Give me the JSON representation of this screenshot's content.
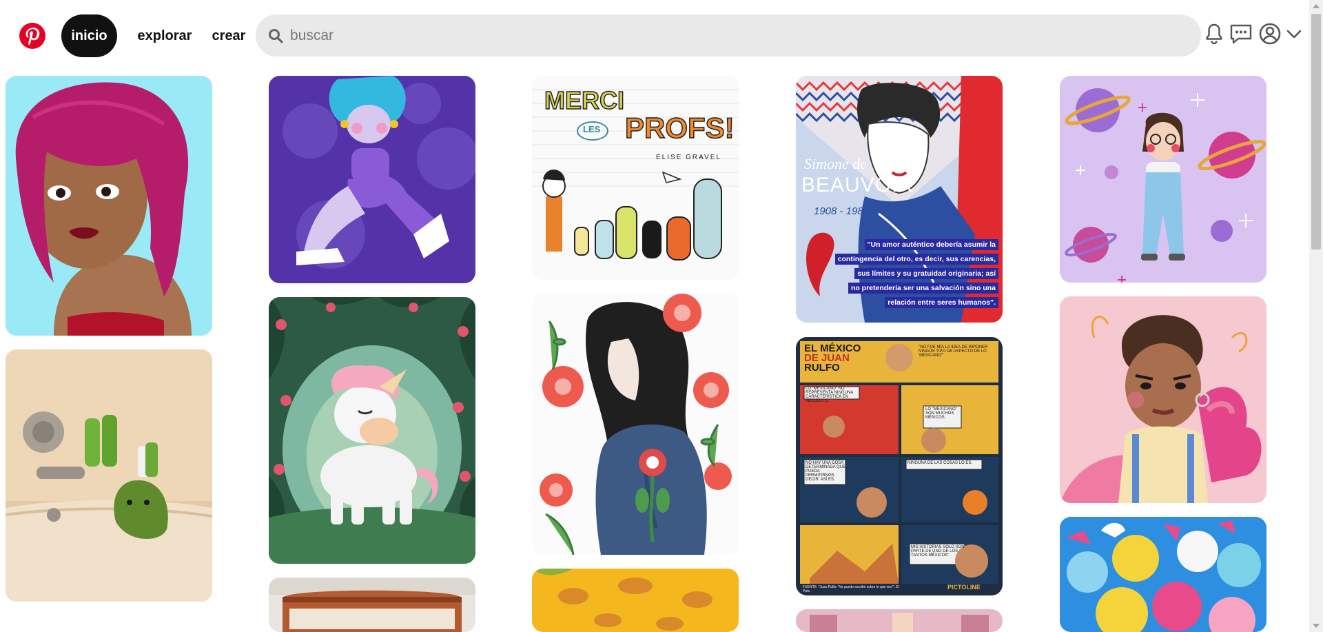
{
  "header": {
    "logo_icon": "pinterest-logo-icon",
    "nav": [
      {
        "label": "inicio",
        "active": true
      },
      {
        "label": "explorar",
        "active": false
      },
      {
        "label": "crear",
        "active": false
      }
    ],
    "search": {
      "placeholder": "buscar",
      "value": ""
    },
    "icons": [
      "bell-icon",
      "message-icon",
      "profile-icon",
      "chevron-down-icon"
    ]
  },
  "pins": {
    "merci": {
      "line1": "MERCI",
      "line2": "LES",
      "line3": "PROFS!",
      "author": "ELISE GRAVEL"
    },
    "beauvoir": {
      "name1": "Simone de",
      "name2": "BEAUVOIR",
      "years": "1908 - 1986",
      "quote": [
        "\"Un amor auténtico debería asumir la",
        "contingencia del otro, es decir, sus carencias,",
        "sus límites y su gratuidad originaria; así",
        "no pretendería ser una salvación sino una",
        "relación entre seres humanos\"."
      ]
    },
    "rulfo": {
      "title1": "EL MÉXICO",
      "title2": "DE JUAN",
      "title3": "RULFO",
      "b1": "\"NO FUE MÍA LA IDEA DE IMPONER NINGÚN TIPO DE ASPECTO DE LO 'MEXICANO'\"",
      "b2": "LO \"MEXICANO\" NO REPRESENTA NINGUNA CARACTERÍSTICA EN ABSOLUTO.",
      "b3": "LO \"MEXICANO\" SON MUCHOS MÉXICOS.",
      "b4": "NO HAY UNA COSA DETERMINADA QUE PUEDA PERMITIRNOS DECIR: ASÍ ES.",
      "b5": "NINGUNA DE LAS COSAS LO ES.",
      "b6": "MIS HISTORIAS SOLO SON PARTE DE UNO DE LOS TANTOS MÉXICOS\".",
      "source": "FUENTE: \"Juan Rulfo: 'No puedo escribir sobre lo que veo'\". El País.",
      "brand": "PICTOLINE"
    }
  },
  "colors": {
    "brand": "#e60023",
    "active_nav_bg": "#111111",
    "search_bg": "#e9e9e9"
  }
}
